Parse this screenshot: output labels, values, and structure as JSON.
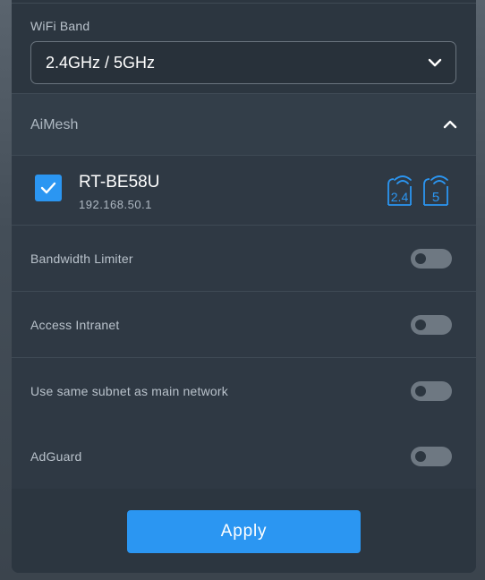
{
  "wifi_band": {
    "label": "WiFi Band",
    "selected": "2.4GHz / 5GHz"
  },
  "aimesh": {
    "title": "AiMesh",
    "node": {
      "checked": true,
      "name": "RT-BE58U",
      "ip": "192.168.50.1",
      "bands": [
        "2.4",
        "5"
      ]
    }
  },
  "options": [
    {
      "label": "Bandwidth Limiter",
      "enabled": false
    },
    {
      "label": "Access Intranet",
      "enabled": false
    },
    {
      "label": "Use same subnet as main network",
      "enabled": false
    },
    {
      "label": "AdGuard",
      "enabled": false
    }
  ],
  "apply_label": "Apply",
  "colors": {
    "accent": "#2b96f2",
    "band_icon": "#2b96f2",
    "toggle_off": "#6e7882"
  }
}
